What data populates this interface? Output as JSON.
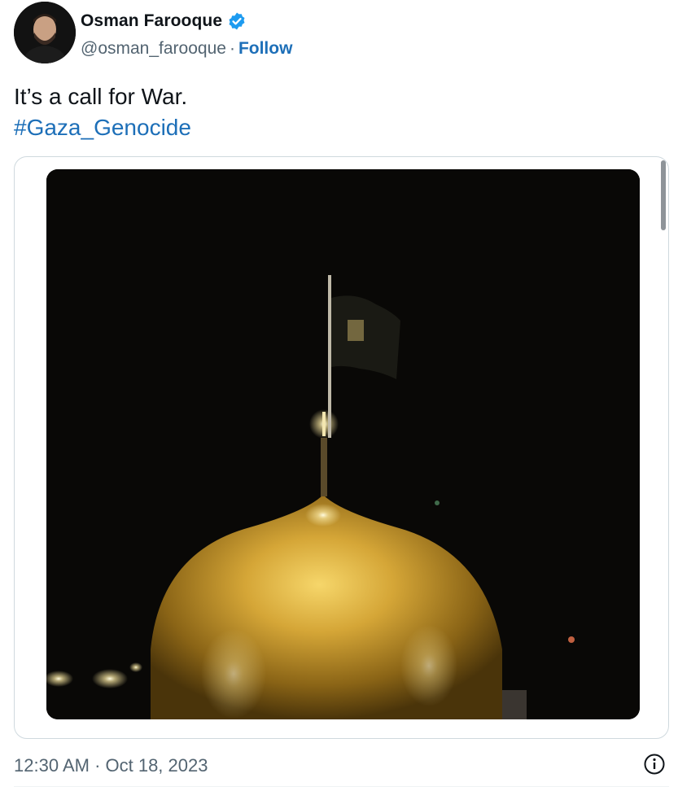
{
  "author": {
    "name": "Osman Farooque",
    "handle": "@osman_farooque",
    "separator": "·",
    "follow_label": "Follow",
    "verified": true
  },
  "tweet": {
    "text": "It’s a call for War.",
    "hashtag": "#Gaza_Genocide"
  },
  "media": {
    "scrollbar_visible": true
  },
  "footer": {
    "timestamp": "12:30 AM · Oct 18, 2023",
    "info_icon": "info-icon"
  },
  "colors": {
    "link": "#1d6fb8",
    "muted": "#536471",
    "verified": "#1d9bf0",
    "border": "#cfd9de"
  }
}
